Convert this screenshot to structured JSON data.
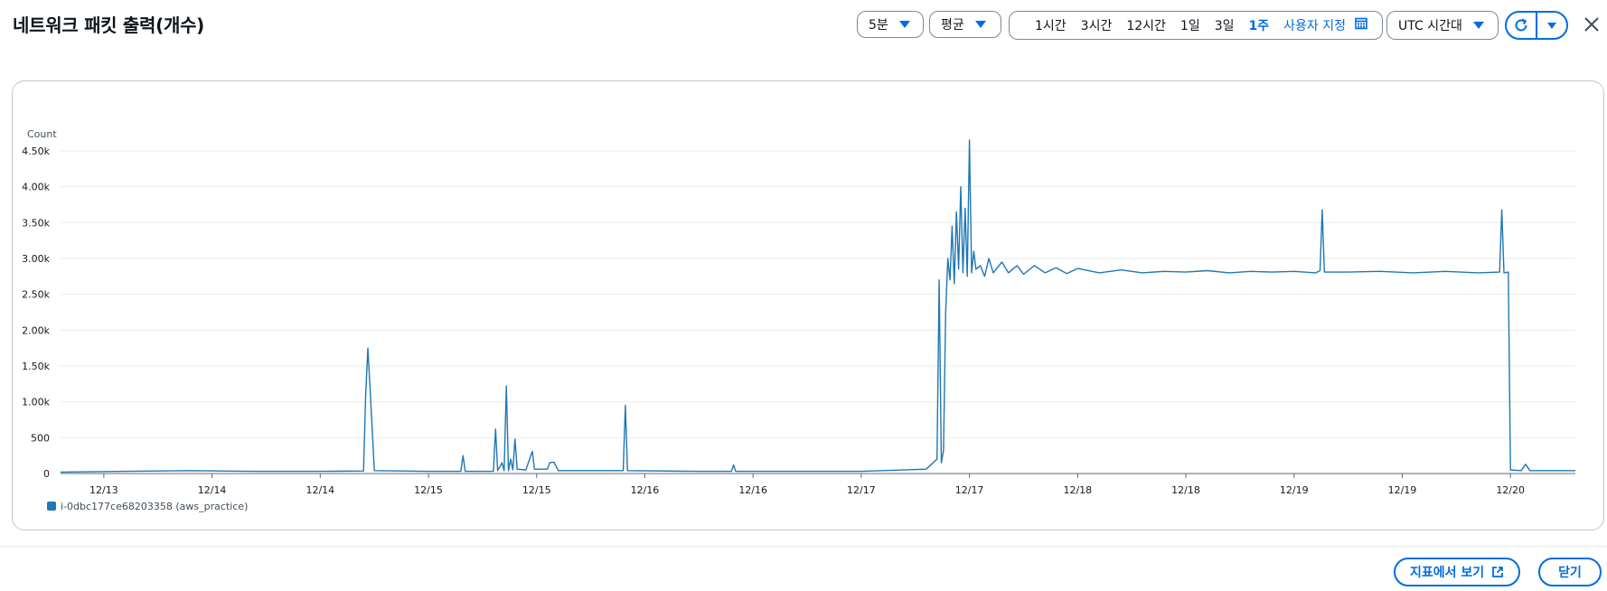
{
  "header": {
    "title": "네트워크 패킷 출력(개수)",
    "period": "5분",
    "statistic": "평균",
    "timezone": "UTC 시간대"
  },
  "ranges": [
    {
      "label": "1시간",
      "active": false
    },
    {
      "label": "3시간",
      "active": false
    },
    {
      "label": "12시간",
      "active": false
    },
    {
      "label": "1일",
      "active": false
    },
    {
      "label": "3일",
      "active": false
    },
    {
      "label": "1주",
      "active": true
    }
  ],
  "custom_range": "사용자 지정",
  "icons": {
    "calendar": "calendar-icon",
    "refresh": "refresh-icon",
    "dropdown": "caret-down-icon",
    "close": "close-icon",
    "external": "external-link-icon"
  },
  "colors": {
    "accent": "#006ce0",
    "series": "#1f77b4",
    "grid": "#e9ebed"
  },
  "footer": {
    "view_in_metrics": "지표에서 보기",
    "close": "닫기"
  },
  "chart_data": {
    "type": "line",
    "ylabel": "Count",
    "ylim": [
      0,
      4500
    ],
    "yticks": [
      0,
      500,
      1000,
      1500,
      2000,
      2500,
      3000,
      3500,
      4000,
      4500
    ],
    "ytick_labels": [
      "0",
      "500",
      "1.00k",
      "1.50k",
      "2.00k",
      "2.50k",
      "3.00k",
      "3.50k",
      "4.00k",
      "4.50k"
    ],
    "xtick_labels": [
      "12/13",
      "12/14",
      "12/14",
      "12/15",
      "12/15",
      "12/16",
      "12/16",
      "12/17",
      "12/17",
      "12/18",
      "12/18",
      "12/19",
      "12/19",
      "12/20"
    ],
    "xlim": [
      -0.4,
      13.6
    ],
    "grid": true,
    "legend": "bottom-left",
    "series": [
      {
        "name": "i-0dbc177ce68203358 (aws_practice)",
        "points": [
          [
            -0.4,
            20
          ],
          [
            0.2,
            30
          ],
          [
            0.8,
            40
          ],
          [
            1.4,
            30
          ],
          [
            2.0,
            30
          ],
          [
            2.4,
            35
          ],
          [
            2.42,
            1100
          ],
          [
            2.44,
            1750
          ],
          [
            2.46,
            1200
          ],
          [
            2.5,
            40
          ],
          [
            3.0,
            30
          ],
          [
            3.3,
            30
          ],
          [
            3.32,
            250
          ],
          [
            3.34,
            30
          ],
          [
            3.6,
            30
          ],
          [
            3.62,
            620
          ],
          [
            3.64,
            40
          ],
          [
            3.68,
            150
          ],
          [
            3.7,
            40
          ],
          [
            3.72,
            1220
          ],
          [
            3.74,
            40
          ],
          [
            3.76,
            200
          ],
          [
            3.78,
            50
          ],
          [
            3.8,
            480
          ],
          [
            3.82,
            60
          ],
          [
            3.9,
            50
          ],
          [
            3.96,
            310
          ],
          [
            3.98,
            60
          ],
          [
            4.1,
            60
          ],
          [
            4.12,
            150
          ],
          [
            4.16,
            160
          ],
          [
            4.2,
            40
          ],
          [
            4.8,
            40
          ],
          [
            4.82,
            950
          ],
          [
            4.84,
            40
          ],
          [
            5.5,
            30
          ],
          [
            5.8,
            30
          ],
          [
            5.82,
            120
          ],
          [
            5.84,
            30
          ],
          [
            6.5,
            30
          ],
          [
            7.0,
            30
          ],
          [
            7.6,
            60
          ],
          [
            7.7,
            200
          ],
          [
            7.72,
            2700
          ],
          [
            7.74,
            150
          ],
          [
            7.76,
            320
          ],
          [
            7.78,
            2250
          ],
          [
            7.8,
            3000
          ],
          [
            7.82,
            2700
          ],
          [
            7.84,
            3450
          ],
          [
            7.86,
            2650
          ],
          [
            7.88,
            3650
          ],
          [
            7.9,
            2850
          ],
          [
            7.92,
            4000
          ],
          [
            7.94,
            2800
          ],
          [
            7.96,
            3700
          ],
          [
            7.98,
            2750
          ],
          [
            8.0,
            4650
          ],
          [
            8.02,
            2800
          ],
          [
            8.04,
            3100
          ],
          [
            8.06,
            2850
          ],
          [
            8.1,
            2900
          ],
          [
            8.14,
            2750
          ],
          [
            8.18,
            3000
          ],
          [
            8.22,
            2800
          ],
          [
            8.3,
            2950
          ],
          [
            8.36,
            2800
          ],
          [
            8.44,
            2900
          ],
          [
            8.5,
            2780
          ],
          [
            8.6,
            2900
          ],
          [
            8.7,
            2800
          ],
          [
            8.8,
            2870
          ],
          [
            8.9,
            2790
          ],
          [
            9.0,
            2860
          ],
          [
            9.2,
            2800
          ],
          [
            9.4,
            2840
          ],
          [
            9.6,
            2800
          ],
          [
            9.8,
            2820
          ],
          [
            10.0,
            2810
          ],
          [
            10.2,
            2830
          ],
          [
            10.4,
            2800
          ],
          [
            10.6,
            2820
          ],
          [
            10.8,
            2810
          ],
          [
            11.0,
            2820
          ],
          [
            11.2,
            2800
          ],
          [
            11.24,
            2830
          ],
          [
            11.26,
            3680
          ],
          [
            11.28,
            2810
          ],
          [
            11.5,
            2810
          ],
          [
            11.8,
            2820
          ],
          [
            12.1,
            2800
          ],
          [
            12.4,
            2820
          ],
          [
            12.7,
            2800
          ],
          [
            12.9,
            2810
          ],
          [
            12.92,
            3680
          ],
          [
            12.94,
            2800
          ],
          [
            12.98,
            2810
          ],
          [
            13.0,
            50
          ],
          [
            13.1,
            40
          ],
          [
            13.14,
            130
          ],
          [
            13.18,
            40
          ],
          [
            13.6,
            40
          ]
        ]
      }
    ]
  }
}
